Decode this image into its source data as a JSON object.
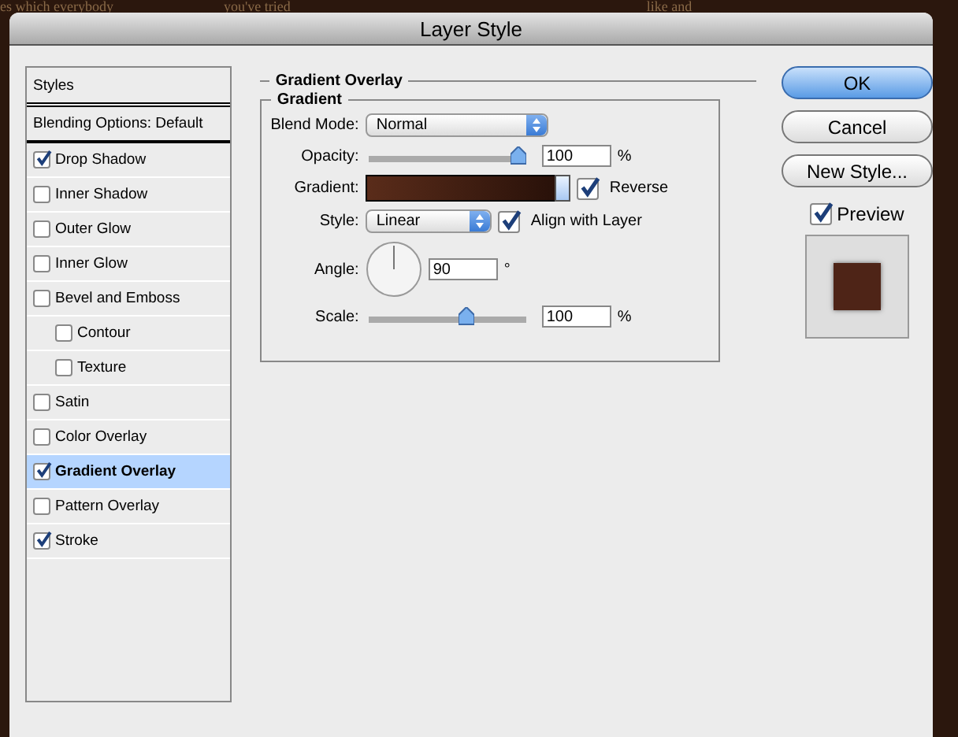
{
  "background_texts": [
    "es which everybody",
    "you've tried",
    "like and"
  ],
  "window": {
    "title": "Layer Style"
  },
  "styles_panel": {
    "header": "Styles",
    "blending": "Blending Options: Default",
    "items": [
      {
        "label": "Drop Shadow",
        "checked": true,
        "selected": false
      },
      {
        "label": "Inner Shadow",
        "checked": false,
        "selected": false
      },
      {
        "label": "Outer Glow",
        "checked": false,
        "selected": false
      },
      {
        "label": "Inner Glow",
        "checked": false,
        "selected": false
      },
      {
        "label": "Bevel and Emboss",
        "checked": false,
        "selected": false,
        "children": [
          {
            "label": "Contour",
            "checked": false,
            "selected": false
          },
          {
            "label": "Texture",
            "checked": false,
            "selected": false
          }
        ]
      },
      {
        "label": "Satin",
        "checked": false,
        "selected": false
      },
      {
        "label": "Color Overlay",
        "checked": false,
        "selected": false
      },
      {
        "label": "Gradient Overlay",
        "checked": true,
        "selected": true
      },
      {
        "label": "Pattern Overlay",
        "checked": false,
        "selected": false
      },
      {
        "label": "Stroke",
        "checked": true,
        "selected": false
      }
    ]
  },
  "gradient_overlay": {
    "title": "Gradient Overlay",
    "group_title": "Gradient",
    "blend_mode": {
      "label": "Blend Mode:",
      "value": "Normal"
    },
    "opacity": {
      "label": "Opacity:",
      "level": 1.0,
      "value": "100",
      "unit": "%"
    },
    "gradient": {
      "label": "Gradient:",
      "reverse": {
        "label": "Reverse",
        "checked": true
      }
    },
    "style": {
      "label": "Style:",
      "value": "Linear",
      "align": {
        "label": "Align with Layer",
        "checked": true
      }
    },
    "angle": {
      "label": "Angle:",
      "value": "90",
      "unit": "°"
    },
    "scale": {
      "label": "Scale:",
      "level": 0.63,
      "value": "100",
      "unit": "%"
    }
  },
  "buttons": [
    {
      "label": "OK",
      "default": true
    },
    {
      "label": "Cancel",
      "default": false
    },
    {
      "label": "New Style...",
      "default": false
    }
  ],
  "preview": {
    "label": "Preview",
    "checked": true
  }
}
